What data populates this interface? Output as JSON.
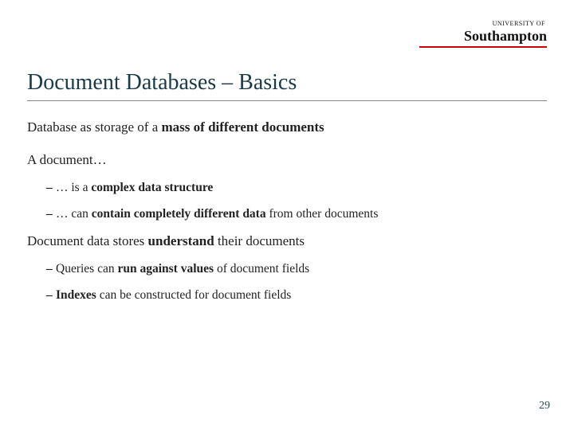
{
  "logo": {
    "caption": "UNIVERSITY OF",
    "name": "Southampton"
  },
  "title": "Document Databases – Basics",
  "body": {
    "line1_pre": "Database as storage of a ",
    "line1_bold": "mass of different documents",
    "line2": "A document…",
    "sub1_pre": "… is a ",
    "sub1_bold": "complex data structure",
    "sub2_pre": "… can ",
    "sub2_bold": "contain completely different data",
    "sub2_post": " from other documents",
    "line3_pre": "Document data stores ",
    "line3_bold": "understand",
    "line3_post": " their documents",
    "sub3_pre": "Queries can ",
    "sub3_bold": "run against values",
    "sub3_post": " of document fields",
    "sub4_bold": "Indexes",
    "sub4_post": " can be constructed for document fields"
  },
  "dash": "–",
  "pagenum": "29"
}
